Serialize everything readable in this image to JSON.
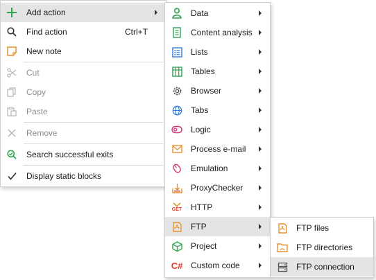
{
  "main_menu": {
    "add_action": "Add action",
    "find_action": "Find action",
    "find_action_shortcut": "Ctrl+T",
    "new_note": "New note",
    "cut": "Cut",
    "copy": "Copy",
    "paste": "Paste",
    "remove": "Remove",
    "search_successful_exits": "Search successful exits",
    "display_static_blocks": "Display static blocks"
  },
  "add_action_submenu": {
    "items": [
      {
        "label": "Data",
        "icon": "person-icon"
      },
      {
        "label": "Content analysis",
        "icon": "document-icon"
      },
      {
        "label": "Lists",
        "icon": "list-icon"
      },
      {
        "label": "Tables",
        "icon": "table-icon"
      },
      {
        "label": "Browser",
        "icon": "gear-icon"
      },
      {
        "label": "Tabs",
        "icon": "globe-icon"
      },
      {
        "label": "Logic",
        "icon": "toggle-icon"
      },
      {
        "label": "Process e-mail",
        "icon": "envelope-icon"
      },
      {
        "label": "Emulation",
        "icon": "mouse-icon"
      },
      {
        "label": "ProxyChecker",
        "icon": "download-icon"
      },
      {
        "label": "HTTP",
        "icon": "get-icon",
        "icon_text": "GET"
      },
      {
        "label": "FTP",
        "icon": "ftp-icon"
      },
      {
        "label": "Project",
        "icon": "cube-icon"
      },
      {
        "label": "Custom code",
        "icon": "csharp-icon",
        "icon_text": "C#"
      }
    ]
  },
  "ftp_submenu": {
    "items": [
      {
        "label": "FTP files",
        "icon": "ftp-files-icon"
      },
      {
        "label": "FTP directories",
        "icon": "folder-icon"
      },
      {
        "label": "FTP connection",
        "icon": "server-icon"
      }
    ]
  },
  "colors": {
    "green": "#2ea44f",
    "orange": "#e8912d",
    "blue": "#2c7be5",
    "red": "#e23c2c",
    "highlight": "#e4e4e4"
  }
}
